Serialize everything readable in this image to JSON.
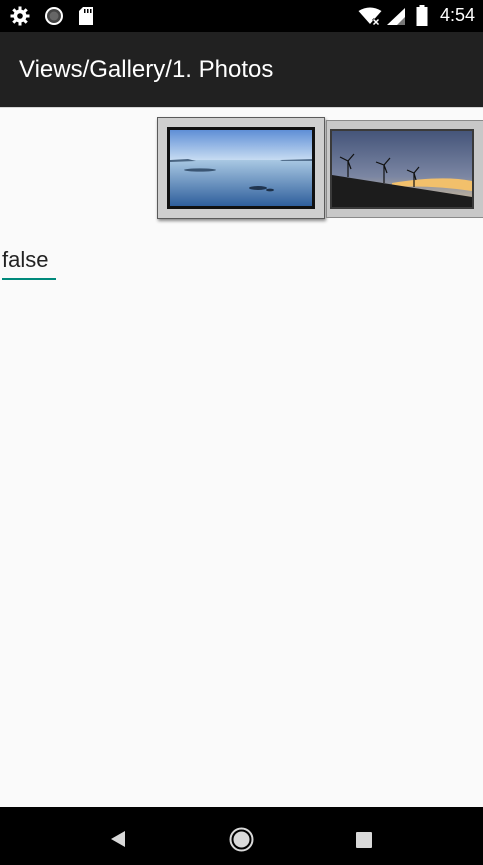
{
  "status_bar": {
    "time": "4:54",
    "icons": [
      "settings-icon",
      "sync-icon",
      "sd-card-icon",
      "wifi-icon",
      "signal-icon",
      "battery-icon"
    ]
  },
  "app_bar": {
    "title": "Views/Gallery/1. Photos"
  },
  "gallery": {
    "items": [
      {
        "subject": "calm lake",
        "selected": true
      },
      {
        "subject": "wind turbines at sunset",
        "selected": false
      }
    ]
  },
  "input": {
    "value": "false"
  },
  "nav_bar": {
    "buttons": [
      "back-icon",
      "home-icon",
      "recents-icon"
    ]
  },
  "colors": {
    "status_bar": "#000000",
    "app_bar": "#212121",
    "background": "#fafafa",
    "accent": "#00897b"
  }
}
